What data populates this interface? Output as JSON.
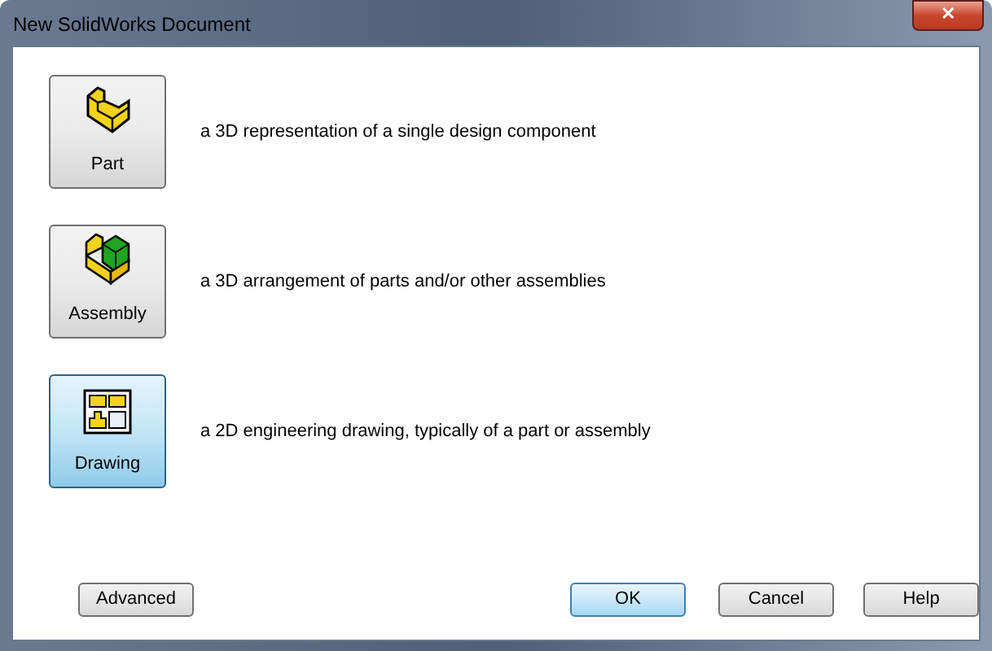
{
  "window": {
    "title": "New SolidWorks Document",
    "close": "✕"
  },
  "document_types": [
    {
      "kind": "part",
      "label": "Part",
      "description": "a 3D representation of a single design component",
      "selected": false
    },
    {
      "kind": "assembly",
      "label": "Assembly",
      "description": "a 3D arrangement of parts and/or other assemblies",
      "selected": false
    },
    {
      "kind": "drawing",
      "label": "Drawing",
      "description": "a 2D engineering drawing, typically of a part or assembly",
      "selected": true
    }
  ],
  "buttons": [
    {
      "label": "Advanced",
      "default": false
    },
    {
      "label": "OK",
      "default": true
    },
    {
      "label": "Cancel",
      "default": false
    },
    {
      "label": "Help",
      "default": false
    }
  ]
}
